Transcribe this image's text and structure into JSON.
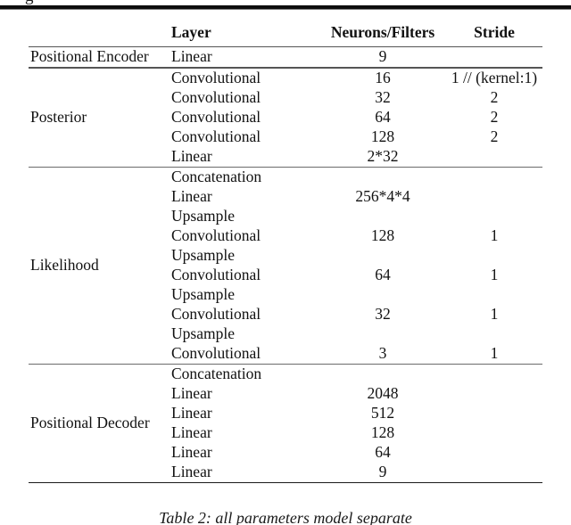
{
  "page": {
    "cropped_line_above": "g",
    "caption": "Table 2: all parameters model separate"
  },
  "table": {
    "columns": [
      "",
      "Layer",
      "Neurons/Filters",
      "Stride"
    ],
    "sections": [
      {
        "group": "Positional Encoder",
        "rows": [
          {
            "layer": "Linear",
            "neurons": "9",
            "stride": ""
          }
        ]
      },
      {
        "group": "Posterior",
        "rows": [
          {
            "layer": "Convolutional",
            "neurons": "16",
            "stride": "1 // (kernel:1)"
          },
          {
            "layer": "Convolutional",
            "neurons": "32",
            "stride": "2"
          },
          {
            "layer": "Convolutional",
            "neurons": "64",
            "stride": "2"
          },
          {
            "layer": "Convolutional",
            "neurons": "128",
            "stride": "2"
          },
          {
            "layer": "Linear",
            "neurons": "2*32",
            "stride": ""
          }
        ]
      },
      {
        "group": "Likelihood",
        "rows": [
          {
            "layer": "Concatenation",
            "neurons": "",
            "stride": ""
          },
          {
            "layer": "Linear",
            "neurons": "256*4*4",
            "stride": ""
          },
          {
            "layer": "Upsample",
            "neurons": "",
            "stride": ""
          },
          {
            "layer": "Convolutional",
            "neurons": "128",
            "stride": "1"
          },
          {
            "layer": "Upsample",
            "neurons": "",
            "stride": ""
          },
          {
            "layer": "Convolutional",
            "neurons": "64",
            "stride": "1"
          },
          {
            "layer": "Upsample",
            "neurons": "",
            "stride": ""
          },
          {
            "layer": "Convolutional",
            "neurons": "32",
            "stride": "1"
          },
          {
            "layer": "Upsample",
            "neurons": "",
            "stride": ""
          },
          {
            "layer": "Convolutional",
            "neurons": "3",
            "stride": "1"
          }
        ]
      },
      {
        "group": "Positional Decoder",
        "rows": [
          {
            "layer": "Concatenation",
            "neurons": "",
            "stride": ""
          },
          {
            "layer": "Linear",
            "neurons": "2048",
            "stride": ""
          },
          {
            "layer": "Linear",
            "neurons": "512",
            "stride": ""
          },
          {
            "layer": "Linear",
            "neurons": "128",
            "stride": ""
          },
          {
            "layer": "Linear",
            "neurons": "64",
            "stride": ""
          },
          {
            "layer": "Linear",
            "neurons": "9",
            "stride": ""
          }
        ]
      }
    ]
  },
  "colors": {
    "text": "#111111",
    "rule_dark": "#1a1a1a",
    "rule_light": "#6b6b6b",
    "background": "#ffffff"
  }
}
